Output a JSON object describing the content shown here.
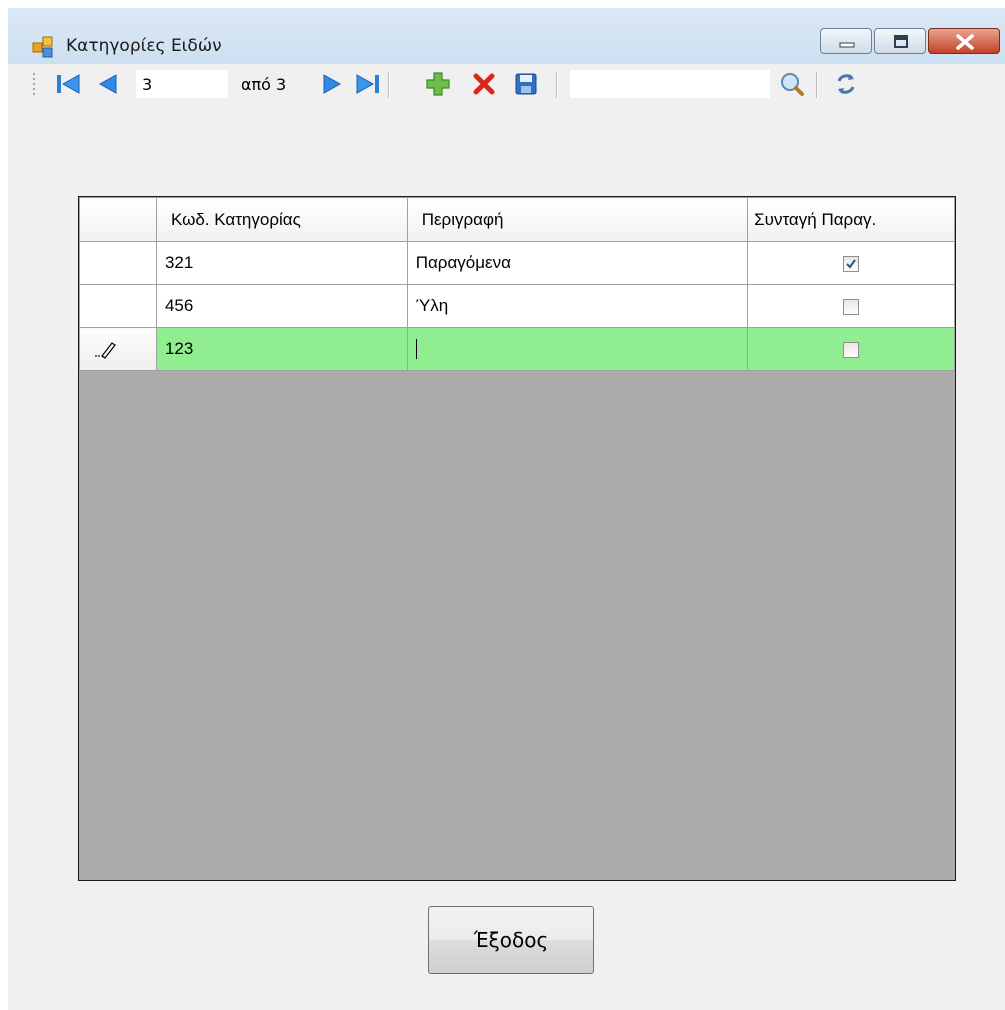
{
  "window": {
    "title": "Κατηγορίες Ειδών",
    "minimize_icon": "minimize-icon",
    "maximize_icon": "maximize-icon",
    "close_icon": "close-icon"
  },
  "toolbar": {
    "first_icon": "move-first-icon",
    "prev_icon": "move-previous-icon",
    "position_value": "3",
    "of_label": "από 3",
    "next_icon": "move-next-icon",
    "last_icon": "move-last-icon",
    "add_icon": "add-new-icon",
    "delete_icon": "delete-icon",
    "save_icon": "save-icon",
    "search_value": "",
    "search_icon": "search-icon",
    "refresh_icon": "refresh-icon"
  },
  "grid": {
    "columns": [
      "Κωδ. Κατηγορίας",
      "Περιγραφή",
      "Συνταγή Παραγ."
    ],
    "rows": [
      {
        "code": "321",
        "description": "Παραγόμενα",
        "recipe": true
      },
      {
        "code": "456",
        "description": "Ύλη",
        "recipe": false
      },
      {
        "code": "123",
        "description": "",
        "recipe": false,
        "editing": true
      }
    ],
    "active_row_color": "#90ee90",
    "background_color": "#ababab"
  },
  "footer": {
    "exit_label": "Έξοδος"
  }
}
